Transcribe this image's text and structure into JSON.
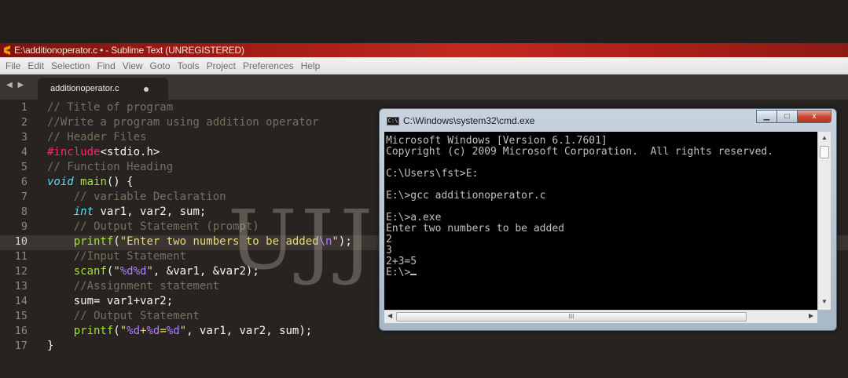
{
  "window": {
    "title": "E:\\additionoperator.c • - Sublime Text (UNREGISTERED)",
    "accent": "#a31c16"
  },
  "menu": [
    "File",
    "Edit",
    "Selection",
    "Find",
    "View",
    "Goto",
    "Tools",
    "Project",
    "Preferences",
    "Help"
  ],
  "tabs": {
    "nav": "◀ ▶",
    "active": {
      "label": "additionoperator.c",
      "modified": true
    }
  },
  "editor": {
    "active_line": 10,
    "line_numbers": [
      "1",
      "2",
      "3",
      "4",
      "5",
      "6",
      "7",
      "8",
      "9",
      "10",
      "11",
      "12",
      "13",
      "14",
      "15",
      "16",
      "17"
    ],
    "lines": [
      "// Title of program",
      "//Write a program using addition operator",
      "// Header Files",
      "#include<stdio.h>",
      "// Function Heading",
      "void main() {",
      "    // variable Declaration",
      "    int var1, var2, sum;",
      "    // Output Statement (prompt)",
      "    printf(\"Enter two numbers to be added\\n\");",
      "    //Input Statement",
      "    scanf(\"%d%d\", &var1, &var2);",
      "    //Assignment statement",
      "    sum= var1+var2;",
      "    // Output Statement",
      "    printf(\"%d+%d=%d\", var1, var2, sum);",
      "}"
    ]
  },
  "watermark": "UJJWAL",
  "cmd": {
    "title": "C:\\Windows\\system32\\cmd.exe",
    "icon_label": "C:\\",
    "buttons": {
      "minimize": "▁",
      "maximize": "□",
      "close": "x"
    },
    "lines": [
      "Microsoft Windows [Version 6.1.7601]",
      "Copyright (c) 2009 Microsoft Corporation.  All rights reserved.",
      "",
      "C:\\Users\\fst>E:",
      "",
      "E:\\>gcc additionoperator.c",
      "",
      "E:\\>a.exe",
      "Enter two numbers to be added",
      "2",
      "3",
      "2+3=5",
      "E:\\>"
    ],
    "scroll_grip": "III"
  }
}
